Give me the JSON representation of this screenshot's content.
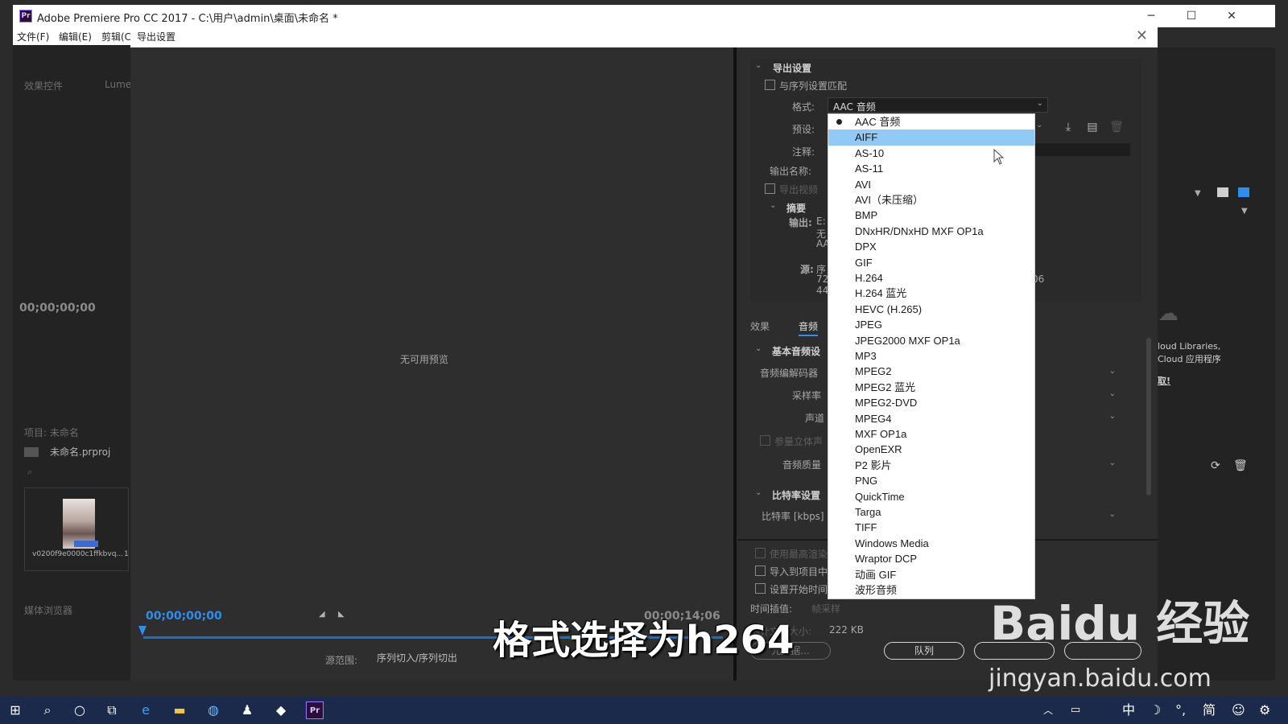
{
  "app": {
    "title": "Adobe Premiere Pro CC 2017 - C:\\用户\\admin\\桌面\\未命名 *",
    "logo": "Pr",
    "menu": [
      "文件(F)",
      "编辑(E)",
      "剪辑(C"
    ]
  },
  "left_panel": {
    "tabs": [
      "效果控件",
      "Lume"
    ],
    "timecode": "00;00;00;00",
    "project_label": "项目: 未命名",
    "project_file": "未命名.prproj",
    "clip_name": "v0200f9e0000c1ffkbvq...",
    "clip_suffix": "1",
    "media_browser": "媒体浏览器"
  },
  "dialog": {
    "title": "导出设置",
    "preview": {
      "no_preview": "无可用预览",
      "timecode_start": "00;00;00;00",
      "timecode_end": "00;00;14;06",
      "source_range_label": "源范围:",
      "source_range_value": "序列切入/序列切出"
    },
    "export_settings": {
      "section_title": "导出设置",
      "match_sequence": "与序列设置匹配",
      "format_label": "格式:",
      "format_value": "AAC 音频",
      "preset_label": "预设:",
      "comment_label": "注释:",
      "output_name_label": "输出名称:",
      "export_video": "导出视频",
      "summary_label": "摘要",
      "output_label": "输出:",
      "output_value": "E:",
      "output_line2": "无",
      "output_line3": "AA",
      "source_label": "源:",
      "source_value": "序",
      "source_line2": "72",
      "source_line3": "44",
      "source_tail": "06"
    },
    "tabs": [
      "效果",
      "音频"
    ],
    "audio": {
      "basic_section": "基本音频设",
      "codec_label": "音频编解码器",
      "sample_rate_label": "采样率",
      "channels_label": "声道",
      "param_stereo": "参量立体声",
      "quality_label": "音频质量",
      "bitrate_section": "比特率设置",
      "bitrate_label": "比特率 [kbps]"
    },
    "bottom": {
      "use_max_render": "使用最高渲染质量",
      "import_to_project": "导入到项目中",
      "set_start_timecode": "设置开始时间码",
      "time_interp_label": "时间插值:",
      "time_interp_value": "帧采样",
      "file_size_label": "估计文件大小:",
      "file_size_value": "222 KB",
      "metadata_btn": "元数据...",
      "queue_btn": "队列"
    }
  },
  "format_dropdown": {
    "selected": "AAC 音频",
    "highlighted": "AIFF",
    "items": [
      "AAC 音频",
      "AIFF",
      "AS-10",
      "AS-11",
      "AVI",
      "AVI（未压缩）",
      "BMP",
      "DNxHR/DNxHD MXF OP1a",
      "DPX",
      "GIF",
      "H.264",
      "H.264 蓝光",
      "HEVC (H.265)",
      "JPEG",
      "JPEG2000 MXF OP1a",
      "MP3",
      "MPEG2",
      "MPEG2 蓝光",
      "MPEG2-DVD",
      "MPEG4",
      "MXF OP1a",
      "OpenEXR",
      "P2 影片",
      "PNG",
      "QuickTime",
      "Targa",
      "TIFF",
      "Windows Media",
      "Wraptor DCP",
      "动画 GIF",
      "波形音频"
    ]
  },
  "right_panel": {
    "cc_libraries_line1": "loud Libraries,",
    "cc_libraries_line2": "Cloud 应用程序",
    "cc_link": "取!"
  },
  "taskbar": {
    "tray": [
      "中",
      "简"
    ]
  },
  "overlay": {
    "subtitle": "格式选择为h264",
    "watermark_logo": "Baidu 经验",
    "watermark_url": "jingyan.baidu.com"
  },
  "colors": {
    "accent": "#2e8ef0",
    "highlight": "#91c9f7",
    "panel_bg": "#2d2d2d",
    "taskbar_bg": "#1b2a4a"
  }
}
